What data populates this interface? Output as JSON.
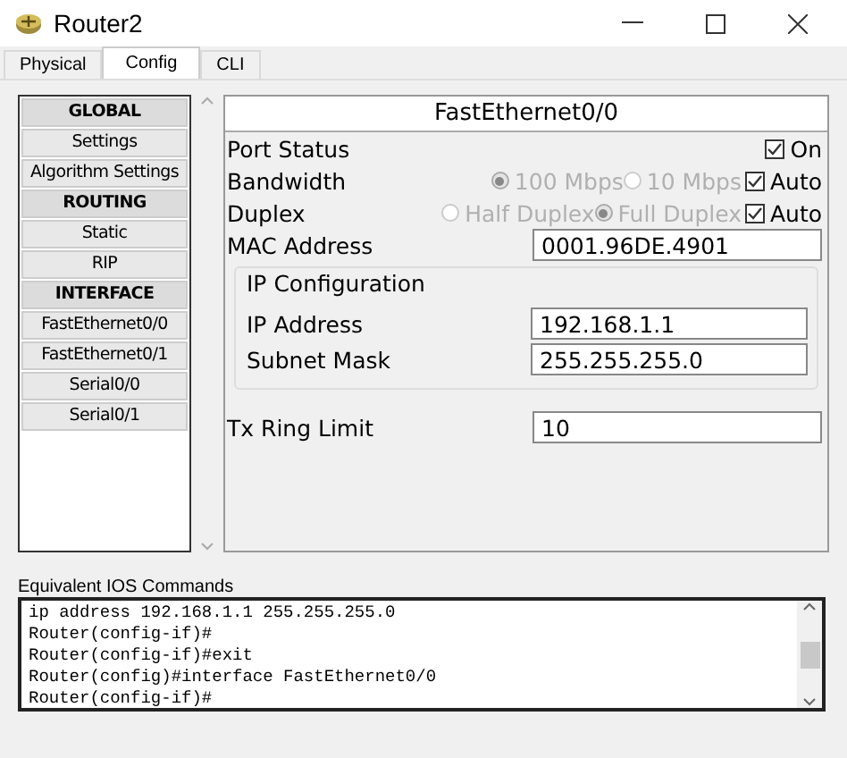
{
  "window": {
    "title": "Router2"
  },
  "tabs": [
    {
      "label": "Physical",
      "selected": false
    },
    {
      "label": "Config",
      "selected": true
    },
    {
      "label": "CLI",
      "selected": false
    }
  ],
  "sidebar": {
    "items": [
      {
        "kind": "header",
        "label": "GLOBAL"
      },
      {
        "kind": "item",
        "label": "Settings"
      },
      {
        "kind": "item",
        "label": "Algorithm Settings"
      },
      {
        "kind": "header",
        "label": "ROUTING"
      },
      {
        "kind": "item",
        "label": "Static"
      },
      {
        "kind": "item",
        "label": "RIP"
      },
      {
        "kind": "header",
        "label": "INTERFACE"
      },
      {
        "kind": "item",
        "label": "FastEthernet0/0"
      },
      {
        "kind": "item",
        "label": "FastEthernet0/1"
      },
      {
        "kind": "item",
        "label": "Serial0/0"
      },
      {
        "kind": "item",
        "label": "Serial0/1"
      }
    ]
  },
  "panel": {
    "title": "FastEthernet0/0",
    "port_status": {
      "label": "Port Status",
      "check_label": "On",
      "checked": true
    },
    "bandwidth": {
      "label": "Bandwidth",
      "disabled": true,
      "options": [
        {
          "label": "100 Mbps",
          "selected": true
        },
        {
          "label": "10 Mbps",
          "selected": false
        }
      ],
      "auto_label": "Auto",
      "auto_checked": true
    },
    "duplex": {
      "label": "Duplex",
      "disabled": true,
      "options": [
        {
          "label": "Half Duplex",
          "selected": false
        },
        {
          "label": "Full Duplex",
          "selected": true
        }
      ],
      "auto_label": "Auto",
      "auto_checked": true
    },
    "mac_address": {
      "label": "MAC Address",
      "value": "0001.96DE.4901"
    },
    "ip_configuration": {
      "title": "IP Configuration",
      "ip_address": {
        "label": "IP Address",
        "value": "192.168.1.1"
      },
      "subnet_mask": {
        "label": "Subnet Mask",
        "value": "255.255.255.0"
      }
    },
    "tx_ring_limit": {
      "label": "Tx Ring Limit",
      "value": "10"
    }
  },
  "commands": {
    "title": "Equivalent IOS Commands",
    "lines": [
      "ip address 192.168.1.1 255.255.255.0",
      "Router(config-if)#",
      "Router(config-if)#exit",
      "Router(config)#interface FastEthernet0/0",
      "Router(config-if)#"
    ]
  }
}
